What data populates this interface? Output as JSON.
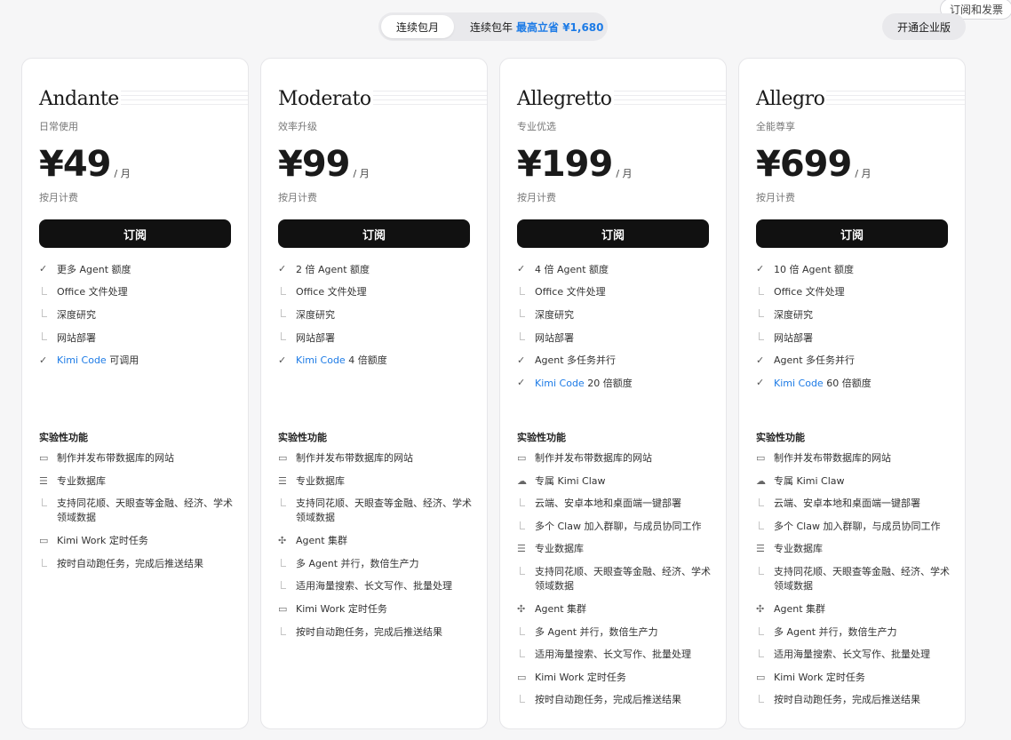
{
  "top": {
    "invoice_tag": "订阅和发票",
    "monthly_label": "连续包月",
    "yearly_label": "连续包年",
    "yearly_save": "最高立省 ¥1,680",
    "enterprise_label": "开通企业版"
  },
  "labels": {
    "per_month": "/ 月",
    "billing_note": "按月计费",
    "subscribe": "订阅",
    "exp_title": "实验性功能"
  },
  "plans": [
    {
      "name": "Andante",
      "tagline": "日常使用",
      "price": "¥49",
      "features": [
        {
          "type": "check",
          "text": "更多 Agent 额度"
        },
        {
          "type": "sub",
          "text": "Office 文件处理"
        },
        {
          "type": "sub",
          "text": "深度研究"
        },
        {
          "type": "sub",
          "text": "网站部署"
        },
        {
          "type": "check",
          "blue": "Kimi Code",
          "text": " 可调用"
        }
      ],
      "experimental": [
        {
          "icon": "browser-icon",
          "text": "制作并发布带数据库的网站"
        },
        {
          "icon": "database-icon",
          "text": "专业数据库"
        },
        {
          "icon": "sub",
          "text": "支持同花顺、天眼查等金融、经济、学术领域数据",
          "two": true
        },
        {
          "icon": "monitor-icon",
          "text": "Kimi Work 定时任务"
        },
        {
          "icon": "sub",
          "text": "按时自动跑任务，完成后推送结果"
        }
      ]
    },
    {
      "name": "Moderato",
      "tagline": "效率升级",
      "price": "¥99",
      "features": [
        {
          "type": "check",
          "text": "2 倍 Agent 额度"
        },
        {
          "type": "sub",
          "text": "Office 文件处理"
        },
        {
          "type": "sub",
          "text": "深度研究"
        },
        {
          "type": "sub",
          "text": "网站部署"
        },
        {
          "type": "check",
          "blue": "Kimi Code",
          "text": " 4 倍额度"
        }
      ],
      "experimental": [
        {
          "icon": "browser-icon",
          "text": "制作并发布带数据库的网站"
        },
        {
          "icon": "database-icon",
          "text": "专业数据库"
        },
        {
          "icon": "sub",
          "text": "支持同花顺、天眼查等金融、经济、学术领域数据",
          "two": true
        },
        {
          "icon": "cluster-icon",
          "text": "Agent 集群"
        },
        {
          "icon": "sub",
          "text": "多 Agent 并行，数倍生产力"
        },
        {
          "icon": "sub",
          "text": "适用海量搜索、长文写作、批量处理"
        },
        {
          "icon": "monitor-icon",
          "text": "Kimi Work 定时任务"
        },
        {
          "icon": "sub",
          "text": "按时自动跑任务，完成后推送结果"
        }
      ]
    },
    {
      "name": "Allegretto",
      "tagline": "专业优选",
      "price": "¥199",
      "features": [
        {
          "type": "check",
          "text": "4 倍 Agent 额度"
        },
        {
          "type": "sub",
          "text": "Office 文件处理"
        },
        {
          "type": "sub",
          "text": "深度研究"
        },
        {
          "type": "sub",
          "text": "网站部署"
        },
        {
          "type": "check",
          "text": "Agent 多任务并行"
        },
        {
          "type": "check",
          "blue": "Kimi Code",
          "text": " 20 倍额度"
        }
      ],
      "experimental": [
        {
          "icon": "browser-icon",
          "text": "制作并发布带数据库的网站"
        },
        {
          "icon": "claw-icon",
          "text": "专属 Kimi Claw"
        },
        {
          "icon": "sub",
          "text": "云端、安卓本地和桌面端一键部署"
        },
        {
          "icon": "sub",
          "text": "多个 Claw 加入群聊，与成员协同工作"
        },
        {
          "icon": "database-icon",
          "text": "专业数据库"
        },
        {
          "icon": "sub",
          "text": "支持同花顺、天眼查等金融、经济、学术领域数据",
          "two": true
        },
        {
          "icon": "cluster-icon",
          "text": "Agent 集群"
        },
        {
          "icon": "sub",
          "text": "多 Agent 并行，数倍生产力"
        },
        {
          "icon": "sub",
          "text": "适用海量搜索、长文写作、批量处理"
        },
        {
          "icon": "monitor-icon",
          "text": "Kimi Work 定时任务"
        },
        {
          "icon": "sub",
          "text": "按时自动跑任务，完成后推送结果"
        }
      ]
    },
    {
      "name": "Allegro",
      "tagline": "全能尊享",
      "price": "¥699",
      "features": [
        {
          "type": "check",
          "text": "10 倍 Agent 额度"
        },
        {
          "type": "sub",
          "text": "Office 文件处理"
        },
        {
          "type": "sub",
          "text": "深度研究"
        },
        {
          "type": "sub",
          "text": "网站部署"
        },
        {
          "type": "check",
          "text": "Agent 多任务并行"
        },
        {
          "type": "check",
          "blue": "Kimi Code",
          "text": " 60 倍额度"
        }
      ],
      "experimental": [
        {
          "icon": "browser-icon",
          "text": "制作并发布带数据库的网站"
        },
        {
          "icon": "claw-icon",
          "text": "专属 Kimi Claw"
        },
        {
          "icon": "sub",
          "text": "云端、安卓本地和桌面端一键部署"
        },
        {
          "icon": "sub",
          "text": "多个 Claw 加入群聊，与成员协同工作"
        },
        {
          "icon": "database-icon",
          "text": "专业数据库"
        },
        {
          "icon": "sub",
          "text": "支持同花顺、天眼查等金融、经济、学术领域数据",
          "two": true
        },
        {
          "icon": "cluster-icon",
          "text": "Agent 集群"
        },
        {
          "icon": "sub",
          "text": "多 Agent 并行，数倍生产力"
        },
        {
          "icon": "sub",
          "text": "适用海量搜索、长文写作、批量处理"
        },
        {
          "icon": "monitor-icon",
          "text": "Kimi Work 定时任务"
        },
        {
          "icon": "sub",
          "text": "按时自动跑任务，完成后推送结果"
        }
      ]
    }
  ]
}
